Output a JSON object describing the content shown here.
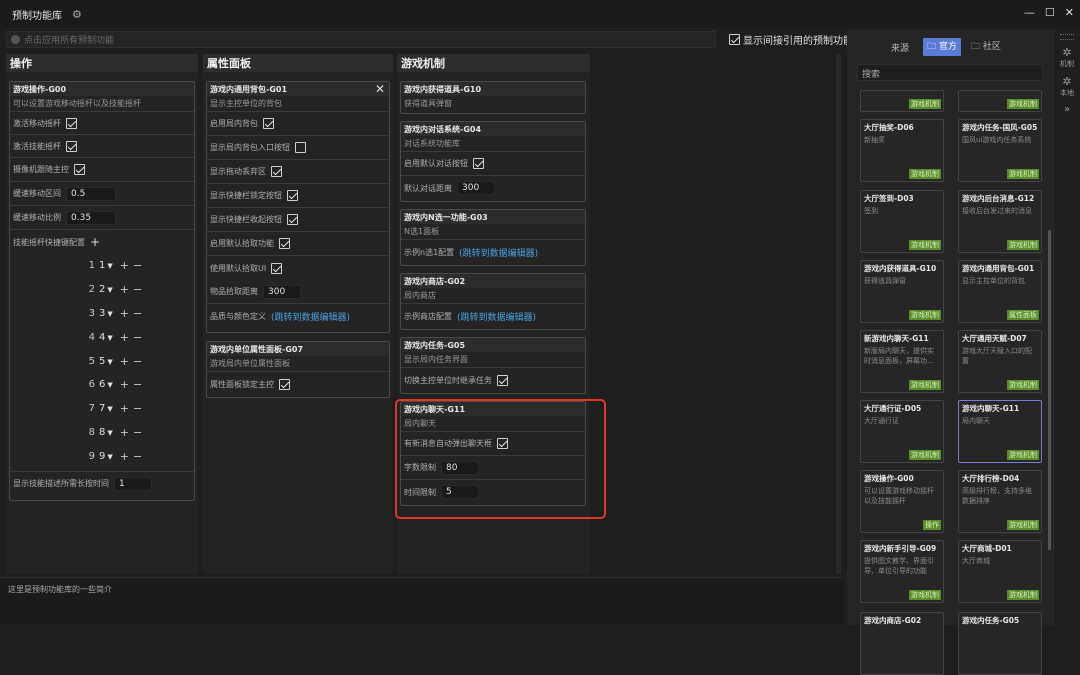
{
  "window": {
    "title": "预制功能库",
    "minimize": "—",
    "maximize": "☐",
    "close": "✕"
  },
  "search_placeholder": "点击应用所有预制功能",
  "show_indirect": "显示间接引用的预制功能",
  "columns": {
    "ops": {
      "header": "操作",
      "card": {
        "title": "游戏操作-G00",
        "desc": "可以设置游戏移动摇杆以及技能摇杆",
        "rows": [
          {
            "label": "激活移动摇杆"
          },
          {
            "label": "激活技能摇杆"
          },
          {
            "label": "摄像机跟随主控"
          }
        ],
        "damp_zone": {
          "label": "缓速移动区间",
          "value": "0.5"
        },
        "damp_ratio": {
          "label": "缓速移动比例",
          "value": "0.35"
        },
        "shortcut_label": "技能摇杆快捷键配置",
        "plus": "+",
        "minus": "−",
        "indices": [
          "1",
          "2",
          "3",
          "4",
          "5",
          "6",
          "7",
          "8",
          "9"
        ],
        "longpress": {
          "label": "显示技能描述所需长按时间",
          "value": "1"
        }
      }
    },
    "attr": {
      "header": "属性面板",
      "card1": {
        "title": "游戏内通用背包-G01",
        "desc": "显示主控单位的背包",
        "rows": [
          {
            "label": "启用局内背包",
            "type": "cb",
            "checked": true
          },
          {
            "label": "显示局内背包入口按钮",
            "type": "cb",
            "checked": false
          },
          {
            "label": "显示拖动丢弃区",
            "type": "cb",
            "checked": true
          },
          {
            "label": "显示快捷栏锁定按钮",
            "type": "cb",
            "checked": true
          },
          {
            "label": "显示快捷栏收起按钮",
            "type": "cb",
            "checked": true
          },
          {
            "label": "启用默认拾取功能",
            "type": "cb",
            "checked": true
          },
          {
            "label": "使用默认拾取UI",
            "type": "cb",
            "checked": true
          }
        ],
        "pickup": {
          "label": "物品拾取距离",
          "value": "300"
        },
        "quality": {
          "label": "品质与颜色定义",
          "link": "(跳转到数据编辑器)"
        },
        "close": "✕"
      },
      "card2": {
        "title": "游戏内单位属性面板-G07",
        "desc": "游戏局内单位属性面板",
        "row": {
          "label": "属性面板锁定主控"
        }
      }
    },
    "mech": {
      "header": "游戏机制",
      "card1": {
        "title": "游戏内获得道具-G10",
        "desc": "获得道具弹窗"
      },
      "card2": {
        "title": "游戏内对话系统-G04",
        "desc": "对话系统功能库",
        "row1": {
          "label": "启用默认对话按钮"
        },
        "row2": {
          "label": "默认对话距离",
          "value": "300"
        }
      },
      "card3": {
        "title": "游戏内N选一功能-G03",
        "desc": "N选1面板",
        "row": {
          "label": "示例n选1配置",
          "link": "(跳转到数据编辑器)"
        }
      },
      "card4": {
        "title": "游戏内商店-G02",
        "desc": "局内商店",
        "row": {
          "label": "示例商店配置",
          "link": "(跳转到数据编辑器)"
        }
      },
      "card5": {
        "title": "游戏内任务-G05",
        "desc": "显示局内任务界面",
        "row": {
          "label": "切换主控单位时继承任务"
        }
      },
      "card6": {
        "title": "游戏内聊天-G11",
        "desc": "局内聊天",
        "row1": {
          "label": "有新消息自动弹出聊天框"
        },
        "row2": {
          "label": "字数限制",
          "value": "80"
        },
        "row3": {
          "label": "时间限制",
          "value": "5"
        }
      }
    }
  },
  "bottom_text": "这里是预制功能库的一些简介",
  "library": {
    "source_label": "来源",
    "tab_official": "官方",
    "tab_community": "社区",
    "search_placeholder": "搜索",
    "tiles": [
      {
        "title": "",
        "desc": "",
        "tag": "游戏机制"
      },
      {
        "title": "",
        "desc": "",
        "tag": "游戏机制"
      },
      {
        "title": "大厅抽奖-D06",
        "desc": "新抽奖",
        "tag": "游戏机制"
      },
      {
        "title": "游戏内任务-国风-G05",
        "desc": "国风ui游戏内任务系统",
        "tag": "游戏机制"
      },
      {
        "title": "大厅签到-D03",
        "desc": "签到",
        "tag": "游戏机制"
      },
      {
        "title": "游戏内后台消息-G12",
        "desc": "接收后台发过来的消息",
        "tag": "游戏机制"
      },
      {
        "title": "游戏内获得道具-G10",
        "desc": "获得道具弹窗",
        "tag": "游戏机制"
      },
      {
        "title": "游戏内通用背包-G01",
        "desc": "显示主控单位的背包",
        "tag": "属性面板"
      },
      {
        "title": "新游戏内聊天-G11",
        "desc": "新版局内聊天，提供实时消息面板，屏幕功...",
        "tag": "游戏机制"
      },
      {
        "title": "大厅通用天赋-D07",
        "desc": "游戏大厅天赋入口的配置",
        "tag": "游戏机制"
      },
      {
        "title": "大厅通行证-D05",
        "desc": "大厅通行证",
        "tag": "游戏机制"
      },
      {
        "title": "游戏内聊天-G11",
        "desc": "局内聊天",
        "tag": "游戏机制"
      },
      {
        "title": "游戏操作-G00",
        "desc": "可以设置游戏移动摇杆以及技能摇杆",
        "tag": "操作"
      },
      {
        "title": "大厅排行榜-D04",
        "desc": "高级排行榜，支持多维数据排序",
        "tag": "游戏机制"
      },
      {
        "title": "游戏内新手引导-G09",
        "desc": "提供图文教学、界面引导、单位引导的功能",
        "tag": "游戏机制"
      },
      {
        "title": "大厅商城-D01",
        "desc": "大厅商城",
        "tag": "游戏机制"
      },
      {
        "title": "游戏内商店-G02",
        "desc": "",
        "tag": ""
      },
      {
        "title": "游戏内任务-G05",
        "desc": "",
        "tag": ""
      }
    ]
  },
  "sidebar": {
    "mechanism": "机制",
    "local": "本地",
    "expand": "»"
  },
  "colors": {
    "accent": "#5b7bd8",
    "tag": "#5a8e2b",
    "highlight": "#e0362b",
    "link": "#4aa3df"
  }
}
